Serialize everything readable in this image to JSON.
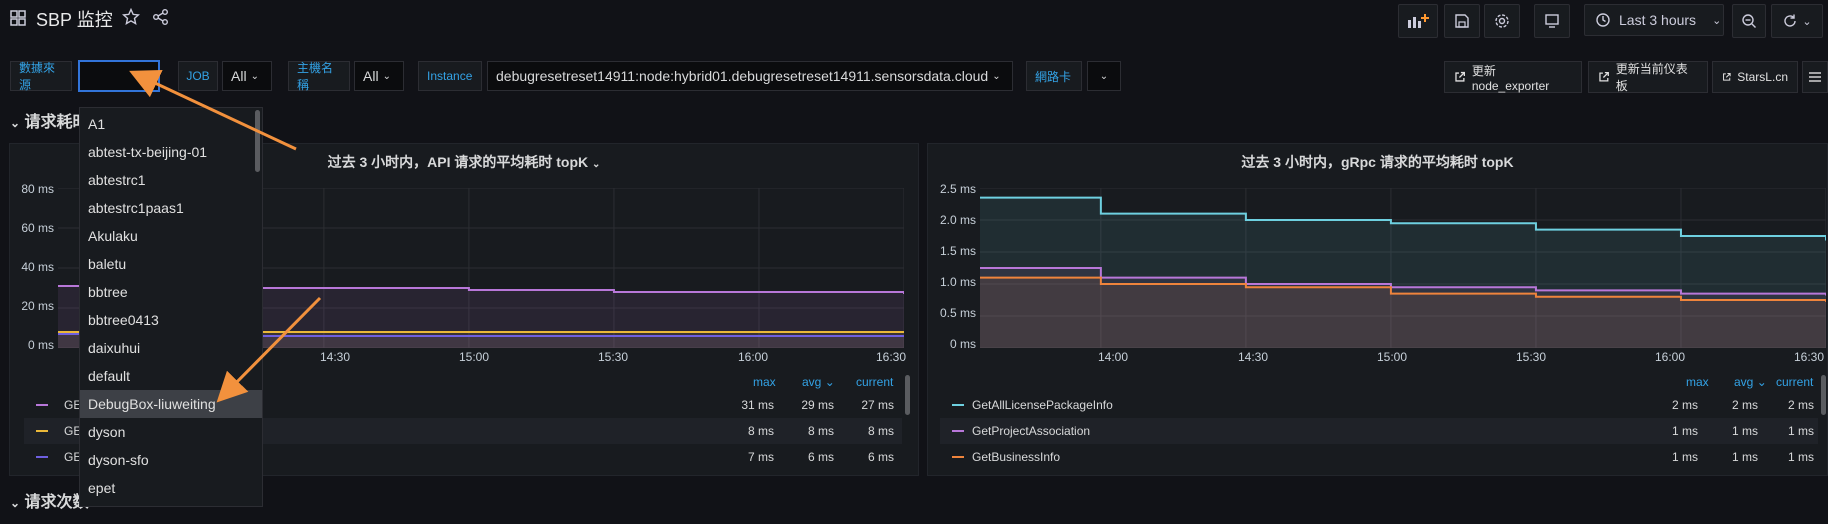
{
  "header": {
    "title": "SBP 监控",
    "time_range": "Last 3 hours"
  },
  "variables": {
    "datasource_label": "數據來源",
    "datasource_value": "",
    "job_label": "JOB",
    "job_value": "All",
    "host_label": "主機名稱",
    "host_value": "All",
    "instance_label": "Instance",
    "instance_value": "debugresetreset14911:node:hybrid01.debugresetreset14911.sensorsdata.cloud",
    "nic_label": "網路卡",
    "nic_value": ""
  },
  "links": {
    "update_node_exporter": "更新node_exporter",
    "update_dashboard": "更新当前仪表板",
    "starsl": "StarsL.cn"
  },
  "rows": {
    "row1_title": "请求耗时",
    "row2_title": "请求次数"
  },
  "dropdown": {
    "items": [
      "A1",
      "abtest-tx-beijing-01",
      "abtestrc1",
      "abtestrc1paas1",
      "Akulaku",
      "baletu",
      "bbtree",
      "bbtree0413",
      "daixuhui",
      "default",
      "DebugBox-liuweiting",
      "dyson",
      "dyson-sfo",
      "epet"
    ],
    "highlighted": "DebugBox-liuweiting"
  },
  "panel_left": {
    "title": "过去 3 小时内，API 请求的平均耗时 topK",
    "legend_headers": {
      "max": "max",
      "avg": "avg",
      "current": "current"
    },
    "legend": [
      {
        "name": "GET",
        "max": "31 ms",
        "avg": "29 ms",
        "current": "27 ms",
        "color": "#b877d9"
      },
      {
        "name": "GET",
        "max": "8 ms",
        "avg": "8 ms",
        "current": "8 ms",
        "color": "#eab839"
      },
      {
        "name": "GET",
        "max": "7 ms",
        "avg": "6 ms",
        "current": "6 ms",
        "color": "#6e5fe0"
      }
    ]
  },
  "panel_right": {
    "title": "过去 3 小时内，gRpc 请求的平均耗时 topK",
    "legend_headers": {
      "max": "max",
      "avg": "avg",
      "current": "current"
    },
    "legend": [
      {
        "name": "GetAllLicensePackageInfo",
        "max": "2 ms",
        "avg": "2 ms",
        "current": "2 ms",
        "color": "#6ed0e0"
      },
      {
        "name": "GetProjectAssociation",
        "max": "1 ms",
        "avg": "1 ms",
        "current": "1 ms",
        "color": "#b877d9"
      },
      {
        "name": "GetBusinessInfo",
        "max": "1 ms",
        "avg": "1 ms",
        "current": "1 ms",
        "color": "#ef843c"
      }
    ]
  },
  "chart_data": [
    {
      "type": "line",
      "title": "过去 3 小时内，API 请求的平均耗时 topK",
      "y_ticks": [
        "80 ms",
        "60 ms",
        "40 ms",
        "20 ms",
        "0 ms"
      ],
      "ylim": [
        0,
        80
      ],
      "x_ticks": [
        "14:30",
        "15:00",
        "15:30",
        "16:00",
        "16:30"
      ],
      "xlim": [
        "13:35",
        "16:30"
      ],
      "series": [
        {
          "name": "GET",
          "color": "#b877d9",
          "x": [
            "13:35",
            "14:00",
            "14:30",
            "15:00",
            "15:30",
            "16:00",
            "16:30"
          ],
          "values": [
            31,
            30,
            30,
            29,
            28,
            28,
            27
          ]
        },
        {
          "name": "GET",
          "color": "#eab839",
          "x": [
            "13:35",
            "14:00",
            "14:30",
            "15:00",
            "15:30",
            "16:00",
            "16:30"
          ],
          "values": [
            8,
            8,
            8,
            8,
            8,
            8,
            8
          ]
        },
        {
          "name": "GET",
          "color": "#6e5fe0",
          "x": [
            "13:35",
            "14:00",
            "14:30",
            "15:00",
            "15:30",
            "16:00",
            "16:30"
          ],
          "values": [
            7,
            6,
            6,
            6,
            6,
            6,
            6
          ]
        }
      ]
    },
    {
      "type": "area",
      "title": "过去 3 小时内，gRpc 请求的平均耗时 topK",
      "y_ticks": [
        "2.5 ms",
        "2.0 ms",
        "1.5 ms",
        "1.0 ms",
        "0.5 ms",
        "0 ms"
      ],
      "ylim": [
        0,
        2.5
      ],
      "x_ticks": [
        "14:00",
        "14:30",
        "15:00",
        "15:30",
        "16:00",
        "16:30"
      ],
      "xlim": [
        "13:35",
        "16:30"
      ],
      "series": [
        {
          "name": "GetAllLicensePackageInfo",
          "color": "#6ed0e0",
          "x": [
            "13:35",
            "14:00",
            "14:30",
            "15:00",
            "15:30",
            "16:00",
            "16:30"
          ],
          "values": [
            2.35,
            2.1,
            2.0,
            1.95,
            1.85,
            1.75,
            1.68
          ]
        },
        {
          "name": "GetProjectAssociation",
          "color": "#b877d9",
          "x": [
            "13:35",
            "14:00",
            "14:30",
            "15:00",
            "15:30",
            "16:00",
            "16:30"
          ],
          "values": [
            1.25,
            1.1,
            1.0,
            0.95,
            0.9,
            0.85,
            0.82
          ]
        },
        {
          "name": "GetBusinessInfo",
          "color": "#ef843c",
          "x": [
            "13:35",
            "14:00",
            "14:30",
            "15:00",
            "15:30",
            "16:00",
            "16:30"
          ],
          "values": [
            1.1,
            1.0,
            0.95,
            0.85,
            0.8,
            0.75,
            0.72
          ]
        }
      ]
    }
  ]
}
